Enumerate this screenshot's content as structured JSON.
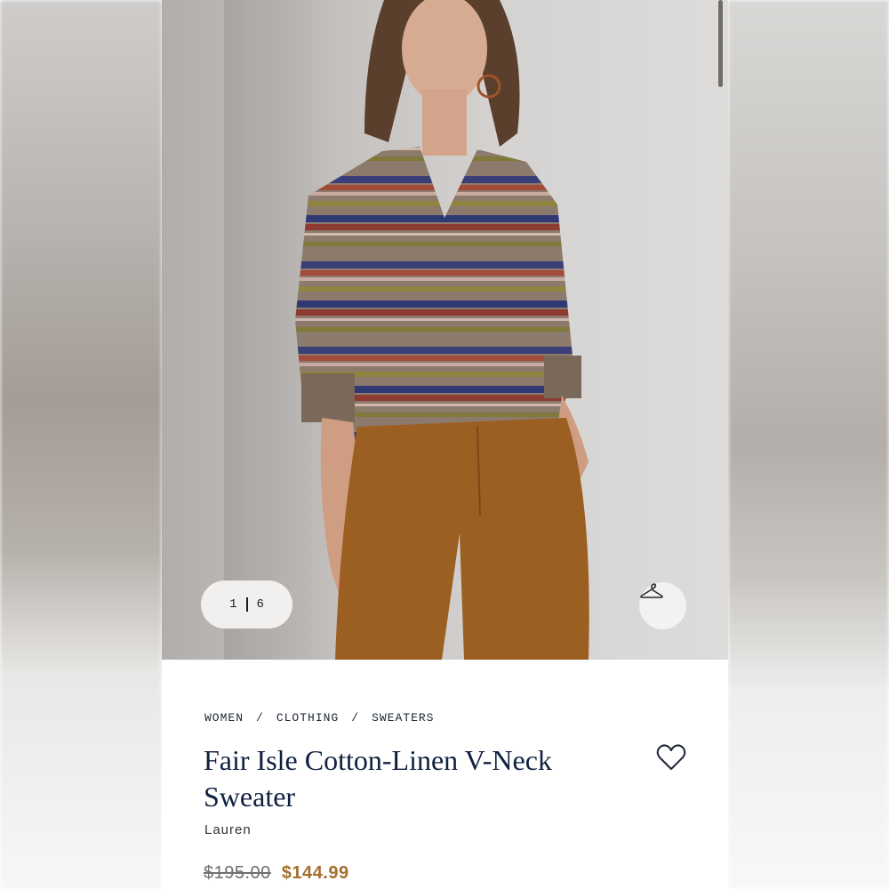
{
  "gallery": {
    "current": "1",
    "total": "6"
  },
  "breadcrumb": [
    "WOMEN",
    "CLOTHING",
    "SWEATERS"
  ],
  "product": {
    "title": "Fair Isle Cotton-Linen V-Neck Sweater",
    "brand": "Lauren",
    "price_original": "$195.00",
    "price_sale": "$144.99"
  },
  "colors": {
    "title": "#102040",
    "sale_price": "#a3702e",
    "hero_bg": "#cfcdcb"
  }
}
